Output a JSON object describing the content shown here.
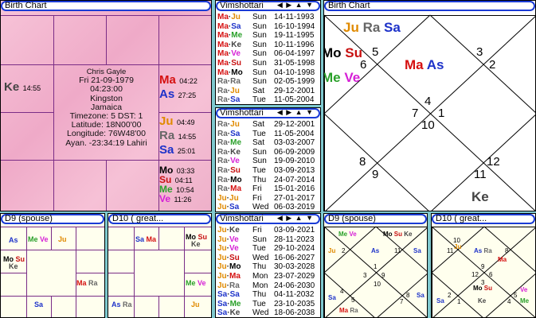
{
  "colors": {
    "ju": "#e08a00",
    "ra": "#666666",
    "sa": "#1d32c9",
    "ma": "#d51010",
    "as": "#1d32c9",
    "ke": "#444444",
    "me": "#2aa02a",
    "ve": "#d61fd6",
    "mo": "#000000",
    "su": "#c81010"
  },
  "birth_chart_south": {
    "title": "Birth Chart",
    "ke": {
      "abbr": "Ke",
      "deg": "14:55"
    },
    "ma": {
      "abbr": "Ma",
      "deg": "04:22"
    },
    "as": {
      "abbr": "As",
      "deg": "27:25"
    },
    "ju": {
      "abbr": "Ju",
      "deg": "04:49"
    },
    "ra": {
      "abbr": "Ra",
      "deg": "14:55"
    },
    "sa": {
      "abbr": "Sa",
      "deg": "25:01"
    },
    "mo": {
      "abbr": "Mo",
      "deg": "03:33"
    },
    "su": {
      "abbr": "Su",
      "deg": "04:11"
    },
    "me": {
      "abbr": "Me",
      "deg": "10:54"
    },
    "ve": {
      "abbr": "Ve",
      "deg": "11:26"
    },
    "info": [
      "Chris Gayle",
      "Fri 21-09-1979",
      "04:23:00",
      "Kingston",
      "Jamaica",
      "Timezone: 5 DST: 1",
      "Latitude: 18N00'00",
      "Longitude: 76W48'00",
      "Ayan. -23:34:19 Lahiri"
    ]
  },
  "vim1": {
    "title": "Vimshottari",
    "nav": "◀ ▶ ▲ ▼",
    "rows": [
      [
        "Ma",
        "Ju",
        "Sun",
        "14-11-1993"
      ],
      [
        "Ma",
        "Sa",
        "Sun",
        "16-10-1994"
      ],
      [
        "Ma",
        "Me",
        "Sun",
        "19-11-1995"
      ],
      [
        "Ma",
        "Ke",
        "Sun",
        "10-11-1996"
      ],
      [
        "Ma",
        "Ve",
        "Sun",
        "06-04-1997"
      ],
      [
        "Ma",
        "Su",
        "Sun",
        "31-05-1998"
      ],
      [
        "Ma",
        "Mo",
        "Sun",
        "04-10-1998"
      ],
      [
        "Ra",
        "Ra",
        "Sun",
        "02-05-1999"
      ],
      [
        "Ra",
        "Ju",
        "Sat",
        "29-12-2001"
      ],
      [
        "Ra",
        "Sa",
        "Tue",
        "11-05-2004"
      ]
    ]
  },
  "vim2": {
    "title": "Vimshottari",
    "nav": "◀ ▶ ▲ ▼",
    "rows": [
      [
        "Ra",
        "Ju",
        "Sat",
        "29-12-2001"
      ],
      [
        "Ra",
        "Sa",
        "Tue",
        "11-05-2004"
      ],
      [
        "Ra",
        "Me",
        "Sat",
        "03-03-2007"
      ],
      [
        "Ra",
        "Ke",
        "Sun",
        "06-09-2009"
      ],
      [
        "Ra",
        "Ve",
        "Sun",
        "19-09-2010"
      ],
      [
        "Ra",
        "Su",
        "Tue",
        "03-09-2013"
      ],
      [
        "Ra",
        "Mo",
        "Thu",
        "24-07-2014"
      ],
      [
        "Ra",
        "Ma",
        "Fri",
        "15-01-2016"
      ],
      [
        "Ju",
        "Ju",
        "Fri",
        "27-01-2017"
      ],
      [
        "Ju",
        "Sa",
        "Wed",
        "06-03-2019"
      ]
    ]
  },
  "vim3": {
    "title": "Vimshottari",
    "nav": "◀ ▶ ▲ ▼",
    "rows": [
      [
        "Ju",
        "Ke",
        "Fri",
        "03-09-2021"
      ],
      [
        "Ju",
        "Ve",
        "Sun",
        "28-11-2023"
      ],
      [
        "Ju",
        "Ve",
        "Tue",
        "29-10-2024"
      ],
      [
        "Ju",
        "Su",
        "Wed",
        "16-06-2027"
      ],
      [
        "Ju",
        "Mo",
        "Thu",
        "30-03-2028"
      ],
      [
        "Ju",
        "Ma",
        "Mon",
        "23-07-2029"
      ],
      [
        "Ju",
        "Ra",
        "Mon",
        "24-06-2030"
      ],
      [
        "Sa",
        "Sa",
        "Thu",
        "04-11-2032"
      ],
      [
        "Sa",
        "Me",
        "Tue",
        "23-10-2035"
      ],
      [
        "Sa",
        "Ke",
        "Wed",
        "18-06-2038"
      ]
    ]
  },
  "north_chart": {
    "title": "Birth Chart",
    "planets": {
      "ju": "Ju",
      "ra": "Ra",
      "sa": "Sa",
      "mo": "Mo",
      "su": "Su",
      "me": "Me",
      "ve": "Ve",
      "ma": "Ma",
      "as": "As",
      "ke": "Ke"
    },
    "houses": [
      "5",
      "6",
      "3",
      "2",
      "4",
      "7",
      "1",
      "10",
      "8",
      "9",
      "12",
      "11"
    ]
  },
  "d9_south": {
    "title": "D9  (spouse)",
    "cells": {
      "as1": "As",
      "me": "Me",
      "ve": "Ve",
      "ju": "Ju",
      "mo": "Mo",
      "su": "Su",
      "ke": "Ke",
      "ma": "Ma",
      "ra": "Ra",
      "sa": "Sa"
    }
  },
  "d10_south": {
    "title": "D10 ( great...",
    "cells": {
      "sa": "Sa",
      "ma": "Ma",
      "mo": "Mo",
      "su": "Su",
      "ke": "Ke",
      "me": "Me",
      "ve": "Ve",
      "as": "As",
      "ra": "Ra",
      "ju": "Ju"
    }
  },
  "d9_north": {
    "title": "D9  (spouse)",
    "labels": {
      "me": "Me",
      "ve": "Ve",
      "mo": "Mo",
      "su": "Su",
      "ke": "Ke",
      "ju": "Ju",
      "as": "As",
      "sa": "Sa",
      "ma": "Ma",
      "ra": "Ra"
    },
    "houses": [
      "2",
      "1",
      "11",
      "10",
      "12",
      "3",
      "9",
      "6",
      "4",
      "5",
      "8",
      "7"
    ]
  },
  "d10_north": {
    "title": "D10 ( great...",
    "labels": {
      "ju": "Ju",
      "as": "As",
      "ra": "Ra",
      "ma": "Ma",
      "mo": "Mo",
      "su": "Su",
      "ke": "Ke",
      "sa": "Sa",
      "me": "Me",
      "ve": "Ve"
    },
    "houses": [
      "10",
      "11",
      "9",
      "8",
      "12",
      "6",
      "2",
      "5",
      "1",
      "3",
      "4",
      "7"
    ]
  }
}
